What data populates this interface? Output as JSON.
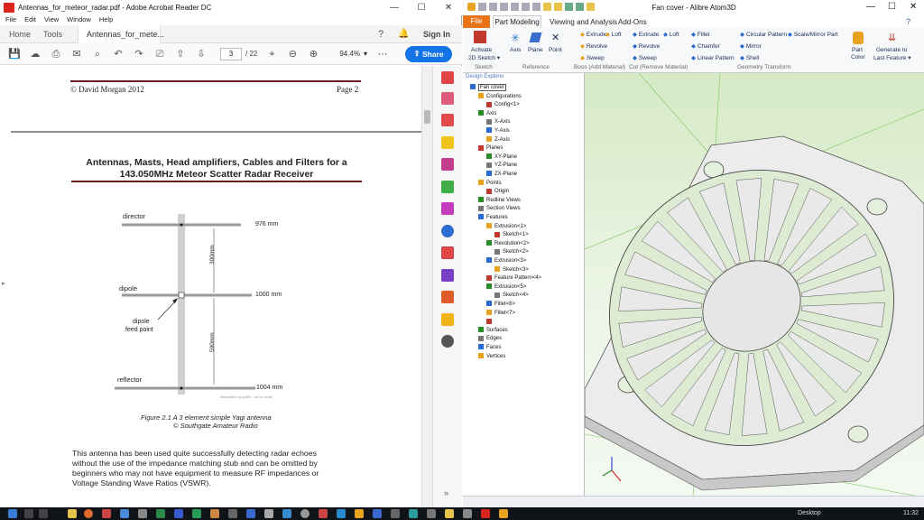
{
  "acrobat": {
    "title": "Antennas_for_meteor_radar.pdf - Adobe Acrobat Reader DC",
    "menu": [
      "File",
      "Edit",
      "View",
      "Window",
      "Help"
    ],
    "tabs": {
      "home": "Home",
      "tools": "Tools",
      "doc": "Antennas_for_mete...",
      "signin": "Sign In"
    },
    "page_current": "3",
    "page_total": "/ 22",
    "zoom": "94.4%",
    "share": "Share",
    "doc": {
      "header_left": "© David Morgan 2012",
      "header_right": "Page 2",
      "heading_line1": "Antennas, Masts, Head amplifiers, Cables and Filters for a",
      "heading_line2": "143.050MHz Meteor Scatter Radar Receiver",
      "diagram": {
        "director": "director",
        "director_len": "976 mm",
        "dipole": "dipole",
        "dipole_len": "1000 mm",
        "feed_line1": "dipole",
        "feed_line2": "feed point",
        "reflector": "reflector",
        "reflector_len": "1004 mm",
        "gap_upper": "300mm",
        "gap_lower": "590mm",
        "credit": "Illustration by g4kkl - not to scale"
      },
      "caption_line1": "Figure 2.1      A   3 element simple Yagi antenna",
      "caption_line2": "© Southgate Amateur Radio",
      "para": [
        "This antenna has been used quite successfully detecting radar echoes",
        "without the use of the impedance matching stub and can be omitted by",
        "beginners who may not have equipment to measure RF impedances or",
        "Voltage Standing Wave Ratios (VSWR)."
      ]
    }
  },
  "alibre": {
    "title": "Fan cover - Alibre Atom3D",
    "ribbon_tabs": [
      "File",
      "Part Modeling",
      "Viewing and Analysis",
      "Add-Ons"
    ],
    "buttons": {
      "activate": [
        "Activate",
        "2D Sketch ▾"
      ],
      "axis": "Axis",
      "plane": "Plane",
      "point": "Point",
      "boss": [
        "Extrude",
        "Revolve",
        "Sweep",
        "Loft"
      ],
      "cut": [
        "Extrude",
        "Revolve",
        "Sweep",
        "Loft"
      ],
      "modify": [
        "Fillet",
        "Chamfer",
        "Shell",
        "Circular Pattern",
        "Mirror",
        "Linear Pattern",
        "Scale/Mirror Part"
      ],
      "color": [
        "Part",
        "Color"
      ],
      "generate": [
        "Generate to",
        "Last Feature ▾"
      ]
    },
    "groups": [
      "Sketch",
      "Reference",
      "Boss (Add Material)",
      "Cut (Remove Material)",
      "Geometry Transform"
    ],
    "explorer_title": "Design Explorer",
    "tree": [
      {
        "label": "Fan cover",
        "indent": 0
      },
      {
        "label": "Configurations",
        "indent": 1
      },
      {
        "label": "Config<1>",
        "indent": 2
      },
      {
        "label": "Axis",
        "indent": 1
      },
      {
        "label": "X-Axis",
        "indent": 2
      },
      {
        "label": "Y-Axis",
        "indent": 2
      },
      {
        "label": "Z-Axis",
        "indent": 2
      },
      {
        "label": "Planes",
        "indent": 1
      },
      {
        "label": "XY-Plane",
        "indent": 2
      },
      {
        "label": "YZ-Plane",
        "indent": 2
      },
      {
        "label": "ZX-Plane",
        "indent": 2
      },
      {
        "label": "Points",
        "indent": 1
      },
      {
        "label": "Origin",
        "indent": 2
      },
      {
        "label": "Redline Views",
        "indent": 1
      },
      {
        "label": "Section Views",
        "indent": 1
      },
      {
        "label": "Features",
        "indent": 1
      },
      {
        "label": "Extrusion<1>",
        "indent": 2
      },
      {
        "label": "Sketch<1>",
        "indent": 3
      },
      {
        "label": "Revolution<2>",
        "indent": 2
      },
      {
        "label": "Sketch<2>",
        "indent": 3
      },
      {
        "label": "Extrusion<3>",
        "indent": 2
      },
      {
        "label": "Sketch<3>",
        "indent": 3
      },
      {
        "label": "Feature Pattern<4>",
        "indent": 2
      },
      {
        "label": "Extrusion<5>",
        "indent": 2
      },
      {
        "label": "Sketch<4>",
        "indent": 3
      },
      {
        "label": "Fillet<6>",
        "indent": 2
      },
      {
        "label": "Fillet<7>",
        "indent": 2
      },
      {
        "label": "",
        "indent": 2
      },
      {
        "label": "Surfaces",
        "indent": 1
      },
      {
        "label": "Edges",
        "indent": 1
      },
      {
        "label": "Faces",
        "indent": 1
      },
      {
        "label": "Vertices",
        "indent": 1
      }
    ]
  },
  "taskbar": {
    "desktop": "Desktop",
    "time": "11:32"
  },
  "colors": {
    "accent": "#1473e6",
    "ribbon_file": "#e8741c",
    "title_rule": "#6a1f1f"
  }
}
